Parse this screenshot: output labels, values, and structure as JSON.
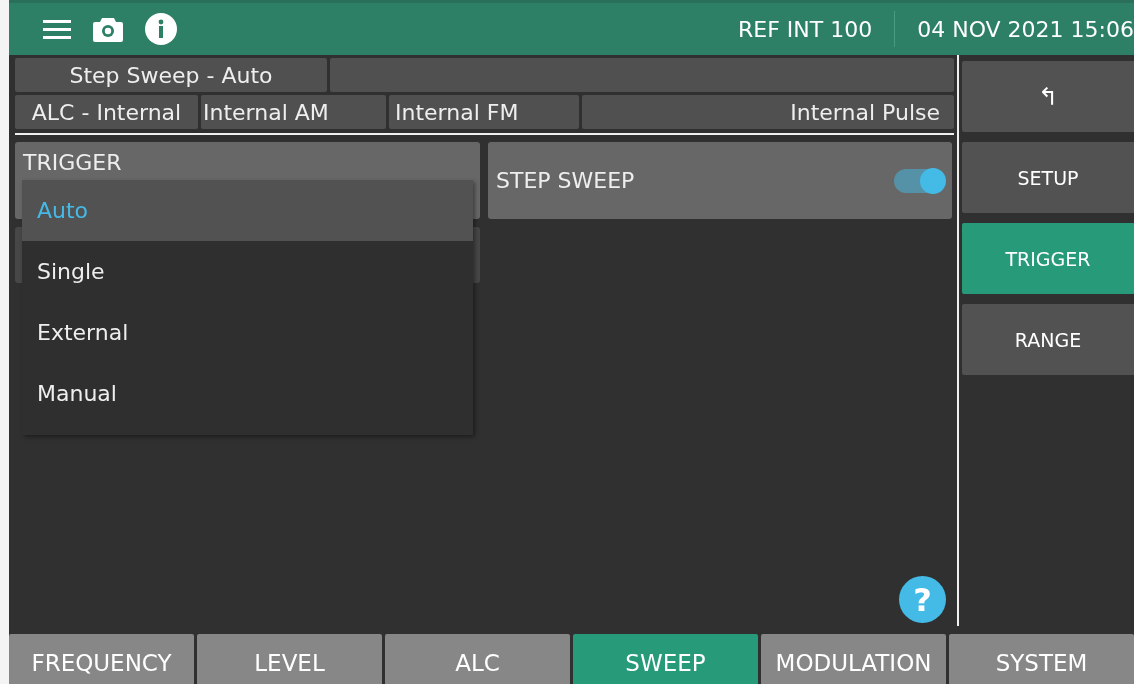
{
  "header": {
    "reference": "REF INT 100",
    "datetime": "04 NOV 2021 15:06"
  },
  "status_rows": [
    [
      "Step Sweep - Auto",
      ""
    ],
    [
      "ALC - Internal",
      "Internal AM",
      "Internal FM",
      "Internal Pulse"
    ]
  ],
  "trigger": {
    "label": "TRIGGER",
    "expanded": true,
    "options": [
      {
        "label": "Auto",
        "selected": true
      },
      {
        "label": "Single",
        "selected": false
      },
      {
        "label": "External",
        "selected": false
      },
      {
        "label": "Manual",
        "selected": false
      }
    ]
  },
  "step_sweep": {
    "label": "STEP SWEEP",
    "on": true
  },
  "help": {
    "symbol": "?"
  },
  "sidebar": {
    "back": "↰",
    "items": [
      {
        "label": "SETUP",
        "selected": false
      },
      {
        "label": "TRIGGER",
        "selected": true
      },
      {
        "label": "RANGE",
        "selected": false
      }
    ]
  },
  "tabs": [
    {
      "label": "FREQUENCY",
      "selected": false
    },
    {
      "label": "LEVEL",
      "selected": false
    },
    {
      "label": "ALC",
      "selected": false
    },
    {
      "label": "SWEEP",
      "selected": true
    },
    {
      "label": "MODULATION",
      "selected": false
    },
    {
      "label": "SYSTEM",
      "selected": false
    }
  ]
}
